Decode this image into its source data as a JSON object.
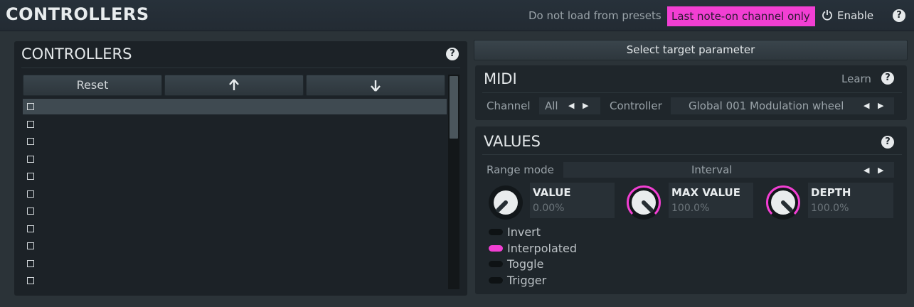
{
  "header": {
    "title": "CONTROLLERS",
    "no_load_label": "Do not load from presets",
    "last_note_label": "Last note-on channel only",
    "enable_label": "Enable",
    "accent_color": "#f23fd3"
  },
  "controllers_panel": {
    "title": "CONTROLLERS",
    "reset_label": "Reset",
    "up_icon": "↑",
    "down_icon": "↓",
    "help_icon": "?",
    "items": [
      {
        "selected": true
      },
      {
        "selected": false
      },
      {
        "selected": false
      },
      {
        "selected": false
      },
      {
        "selected": false
      },
      {
        "selected": false
      },
      {
        "selected": false
      },
      {
        "selected": false
      },
      {
        "selected": false
      },
      {
        "selected": false
      },
      {
        "selected": false
      }
    ]
  },
  "select_target": {
    "label": "Select target parameter"
  },
  "midi": {
    "title": "MIDI",
    "learn_label": "Learn",
    "channel_label": "Channel",
    "channel_value": "All",
    "controller_label": "Controller",
    "controller_value": "Global 001 Modulation wheel",
    "arrows": "◀ ▶"
  },
  "values": {
    "title": "VALUES",
    "range_mode_label": "Range mode",
    "range_mode_value": "Interval",
    "arrows": "◀ ▶",
    "knobs": [
      {
        "title": "VALUE",
        "value": "0.00%",
        "level": 0.0
      },
      {
        "title": "MAX VALUE",
        "value": "100.0%",
        "level": 1.0
      },
      {
        "title": "DEPTH",
        "value": "100.0%",
        "level": 1.0
      }
    ],
    "toggles": [
      {
        "label": "Invert",
        "on": false
      },
      {
        "label": "Interpolated",
        "on": true
      },
      {
        "label": "Toggle",
        "on": false
      },
      {
        "label": "Trigger",
        "on": false
      }
    ]
  }
}
